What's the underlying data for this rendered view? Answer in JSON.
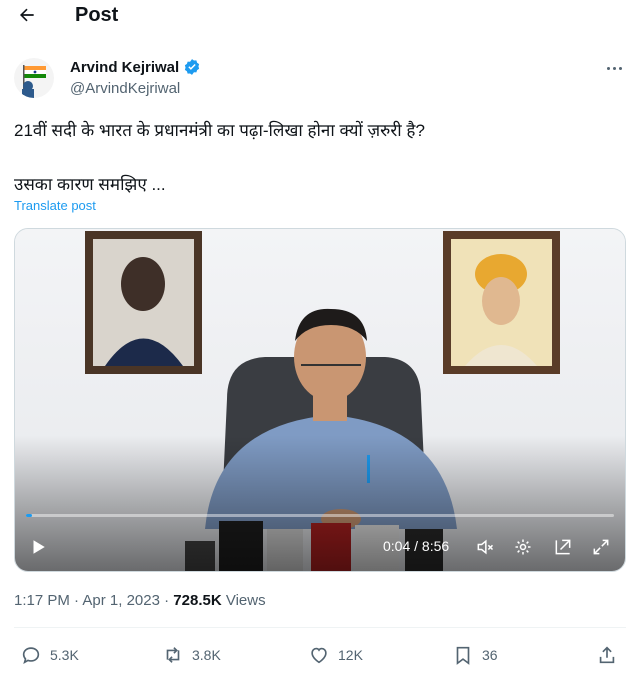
{
  "header": {
    "title": "Post",
    "back_icon": "back-arrow-icon"
  },
  "author": {
    "name": "Arvind Kejriwal",
    "handle": "@ArvindKejriwal",
    "verified_color": "#1d9bf0"
  },
  "post": {
    "line1": "21वीं सदी के भारत के प्रधानमंत्री का पढ़ा-लिखा होना क्यों ज़रुरी है?",
    "line2": "उसका कारण समझिए ...",
    "translate_label": "Translate post"
  },
  "video": {
    "current_time": "0:04",
    "duration": "8:56",
    "time_display": "0:04 / 8:56",
    "progress_fraction": 0.007
  },
  "meta": {
    "time": "1:17 PM",
    "date": "Apr 1, 2023",
    "views_count": "728.5K",
    "views_label": "Views",
    "separator": "·"
  },
  "actions": {
    "replies": "5.3K",
    "reposts": "3.8K",
    "likes": "12K",
    "bookmarks": "36"
  },
  "colors": {
    "accent": "#1d9bf0",
    "text": "#0f1419",
    "muted": "#536471"
  }
}
